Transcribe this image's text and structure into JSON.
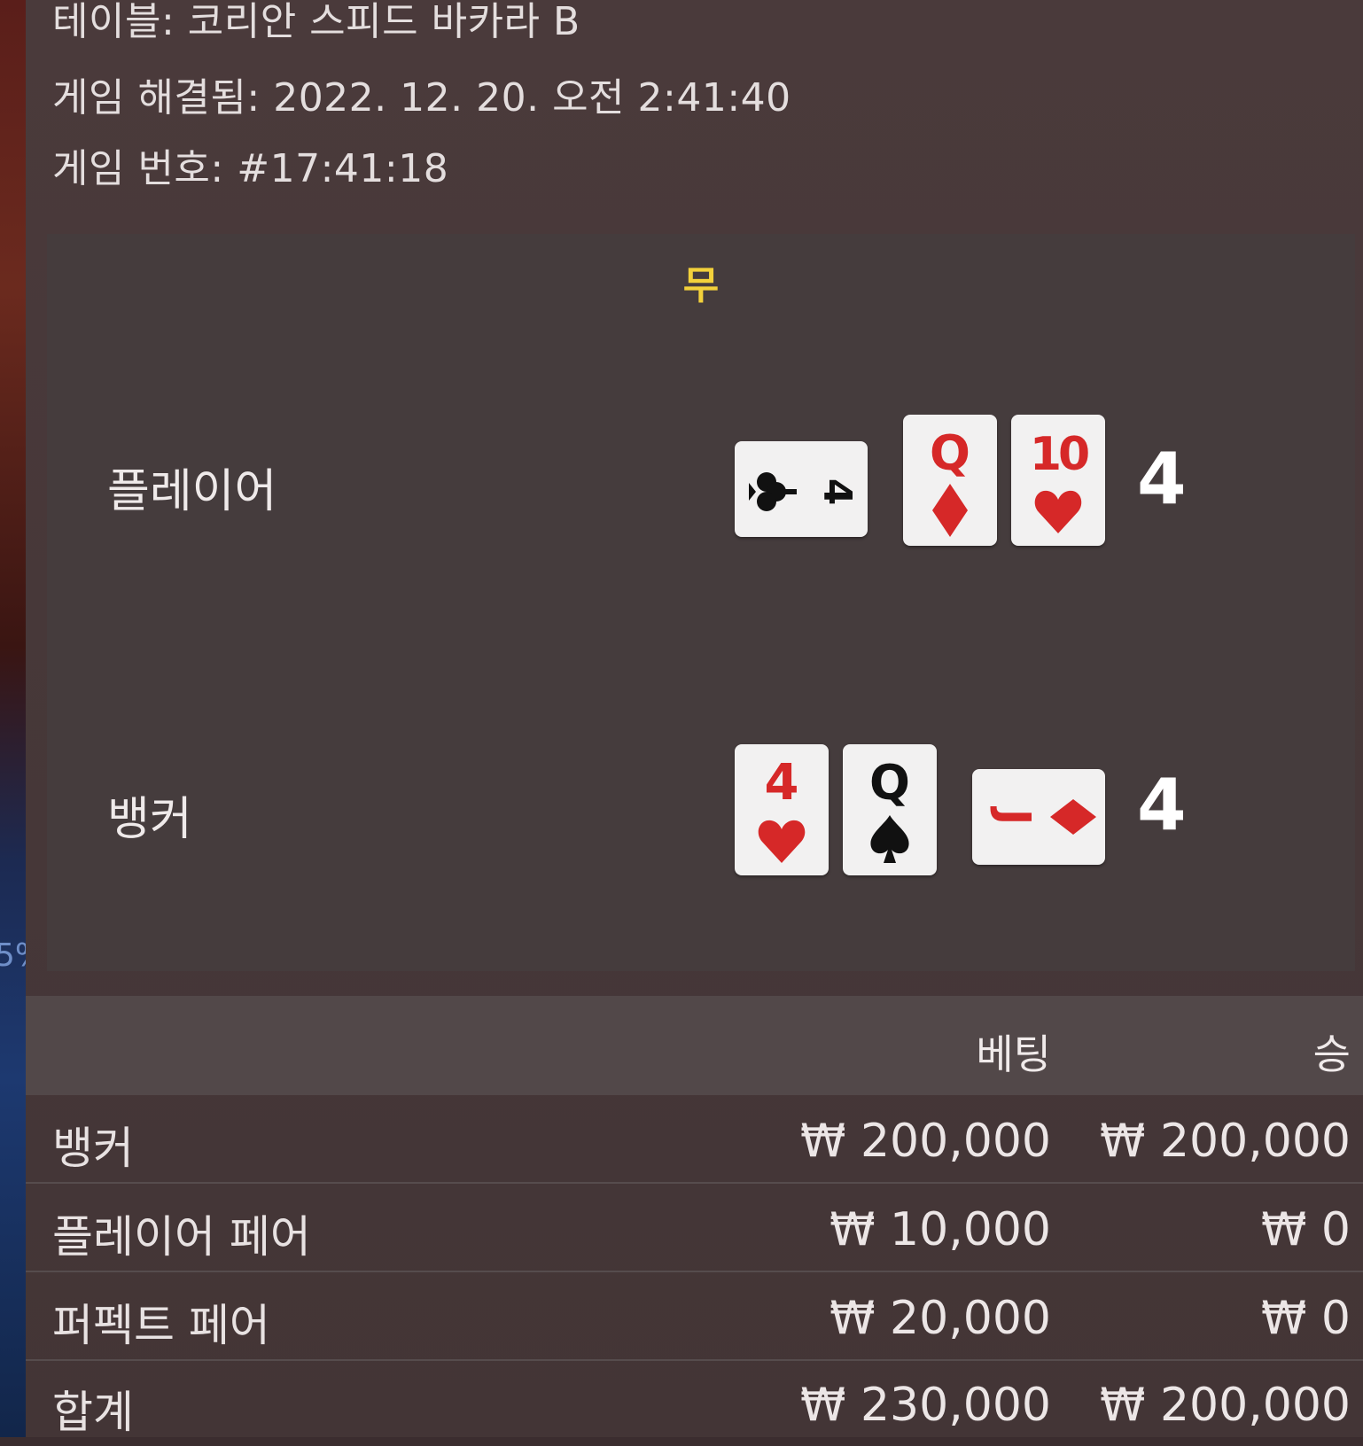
{
  "header": {
    "table_line": "테이블: 코리안 스피드 바카라 B",
    "resolved_line": "게임 해결됨: 2022. 12. 20. 오전 2:41:40",
    "game_number_line": "게임 번호: #17:41:18"
  },
  "side_strip_text": "5%",
  "result": {
    "outcome": "무",
    "player": {
      "label": "플레이어",
      "score": "4",
      "cards": [
        {
          "rank": "4",
          "suit": "clubs",
          "orientation": "sideways"
        },
        {
          "rank": "Q",
          "suit": "diamonds",
          "orientation": "upright"
        },
        {
          "rank": "10",
          "suit": "hearts",
          "orientation": "upright"
        }
      ]
    },
    "banker": {
      "label": "뱅커",
      "score": "4",
      "cards": [
        {
          "rank": "4",
          "suit": "hearts",
          "orientation": "upright"
        },
        {
          "rank": "Q",
          "suit": "spades",
          "orientation": "upright"
        },
        {
          "rank": "J",
          "suit": "diamonds",
          "orientation": "sideways"
        }
      ]
    }
  },
  "bets_table": {
    "columns": [
      "베팅",
      "승"
    ],
    "rows": [
      {
        "label": "뱅커",
        "bet": "₩ 200,000",
        "win": "₩ 200,000"
      },
      {
        "label": "플레이어 페어",
        "bet": "₩ 10,000",
        "win": "₩ 0"
      },
      {
        "label": "퍼펙트 페어",
        "bet": "₩ 20,000",
        "win": "₩ 0"
      },
      {
        "label": "합계",
        "bet": "₩ 230,000",
        "win": "₩ 200,000"
      }
    ]
  },
  "colors": {
    "outcome": "#f3d13b",
    "red_suit": "#d62828",
    "black_suit": "#111111"
  }
}
